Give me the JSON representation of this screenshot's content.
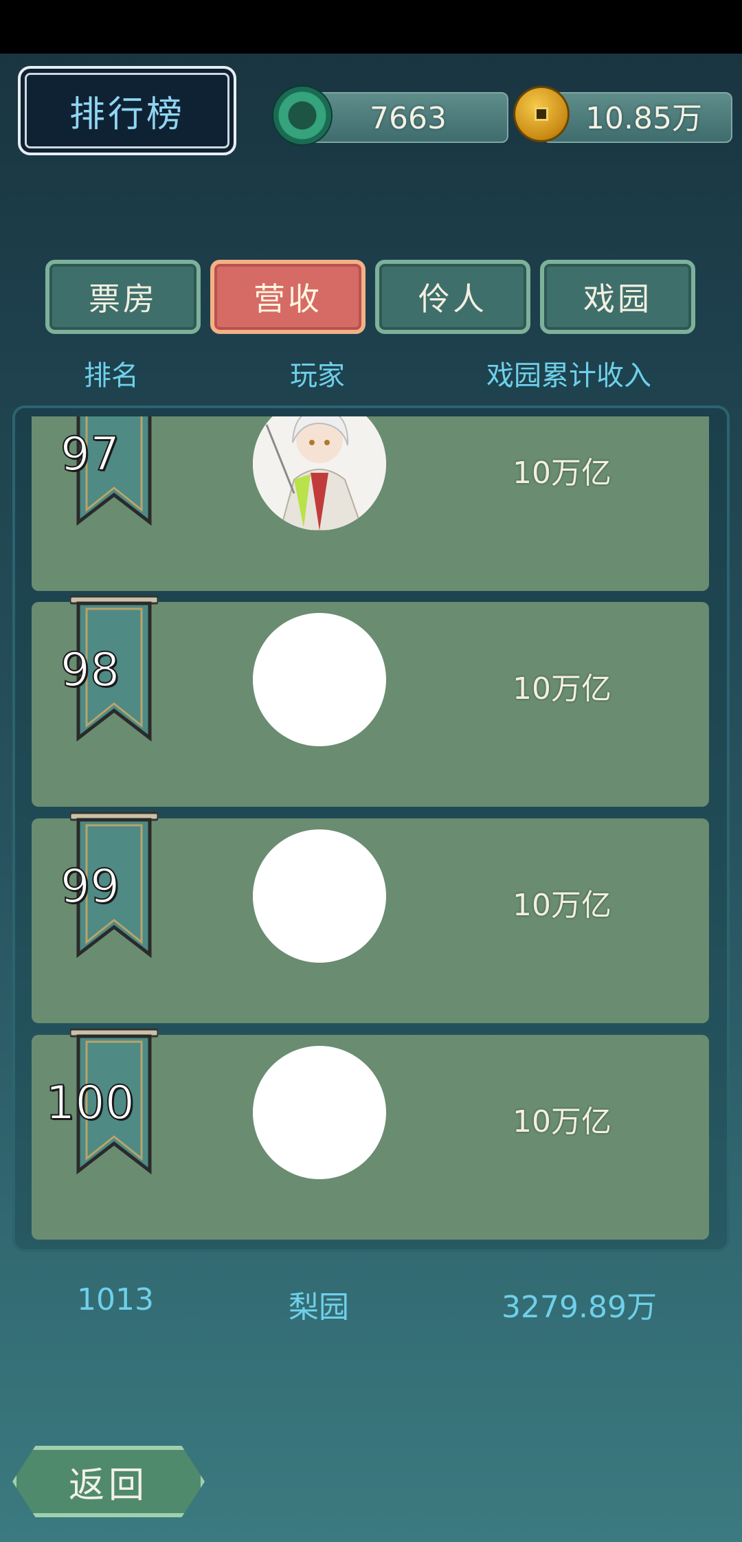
{
  "header": {
    "title": "排行榜",
    "jade_amount": "7663",
    "coin_amount": "10.85万"
  },
  "tabs": [
    {
      "label": "票房",
      "active": false
    },
    {
      "label": "营收",
      "active": true
    },
    {
      "label": "伶人",
      "active": false
    },
    {
      "label": "戏园",
      "active": false
    }
  ],
  "columns": {
    "rank": "排名",
    "player": "玩家",
    "income": "戏园累计收入"
  },
  "rows": [
    {
      "rank": "97",
      "income": "10万亿"
    },
    {
      "rank": "98",
      "income": "10万亿"
    },
    {
      "rank": "99",
      "income": "10万亿"
    },
    {
      "rank": "100",
      "income": "10万亿"
    }
  ],
  "my_rank": {
    "rank": "1013",
    "name": "梨园",
    "income": "3279.89万"
  },
  "footer": {
    "back_label": "返回"
  },
  "colors": {
    "accent_text": "#6fd0ea",
    "row_bg": "#6a8c71",
    "active_tab": "#d66b66"
  }
}
